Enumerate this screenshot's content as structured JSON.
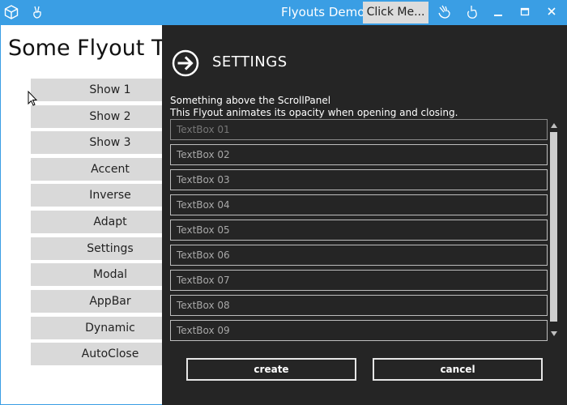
{
  "window": {
    "title": "Flyouts Demo",
    "click_me_label": "Click Me...",
    "accent_color": "#3a9ee4",
    "icons": [
      "app-cube-icon",
      "pin-hand-icon",
      "hand-icon",
      "hand-point-icon",
      "minimize-icon",
      "maximize-icon",
      "close-icon"
    ]
  },
  "main": {
    "heading": "Some Flyout Te",
    "buttons": [
      "Show 1",
      "Show 2",
      "Show 3",
      "Accent",
      "Inverse",
      "Adapt",
      "Settings",
      "Modal",
      "AppBar",
      "Dynamic",
      "AutoClose"
    ]
  },
  "flyout": {
    "title": "SETTINGS",
    "above_text": "Something above the ScrollPanel",
    "animation_text": "This Flyout animates its opacity when opening and closing.",
    "textboxes": [
      "TextBox 01",
      "TextBox 02",
      "TextBox 03",
      "TextBox 04",
      "TextBox 05",
      "TextBox 06",
      "TextBox 07",
      "TextBox 08",
      "TextBox 09"
    ],
    "create_label": "create",
    "cancel_label": "cancel",
    "background_color": "#252525"
  }
}
